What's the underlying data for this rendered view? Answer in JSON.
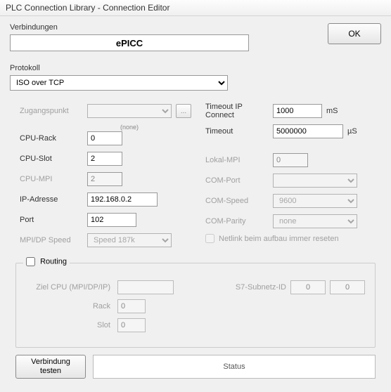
{
  "window": {
    "title": "PLC Connection Library - Connection Editor"
  },
  "labels": {
    "verbindungen": "Verbindungen",
    "protokoll": "Protokoll",
    "zugangspunkt": "Zugangspunkt",
    "none": "(none)",
    "cpu_rack": "CPU-Rack",
    "cpu_slot": "CPU-Slot",
    "cpu_mpi": "CPU-MPI",
    "ip_adresse": "IP-Adresse",
    "port": "Port",
    "mpi_dp_speed": "MPI/DP Speed",
    "timeout_ip": "Timeout IP Connect",
    "timeout": "Timeout",
    "lokal_mpi": "Lokal-MPI",
    "com_port": "COM-Port",
    "com_speed": "COM-Speed",
    "com_parity": "COM-Parity",
    "netlink": "Netlink beim aufbau immer reseten",
    "routing": "Routing",
    "ziel_cpu": "Ziel CPU (MPI/DP/IP)",
    "rack": "Rack",
    "slot": "Slot",
    "s7_subnetz": "S7-Subnetz-ID",
    "test": "Verbindung\ntesten",
    "status": "Status",
    "ok": "OK",
    "browse": "...",
    "ms": "mS",
    "us": "µS"
  },
  "values": {
    "connection_name": "ePICC",
    "protokoll": "ISO over TCP",
    "zugangspunkt": "",
    "cpu_rack": "0",
    "cpu_slot": "2",
    "cpu_mpi": "2",
    "ip_adresse": "192.168.0.2",
    "port": "102",
    "mpi_dp_speed": "Speed 187k",
    "timeout_ip": "1000",
    "timeout": "5000000",
    "lokal_mpi": "0",
    "com_port": "",
    "com_speed": "9600",
    "com_parity": "none",
    "netlink_checked": false,
    "routing_checked": false,
    "ziel_cpu": "",
    "rack": "0",
    "slot": "0",
    "s7_subnetz_a": "0",
    "s7_subnetz_b": "0"
  }
}
